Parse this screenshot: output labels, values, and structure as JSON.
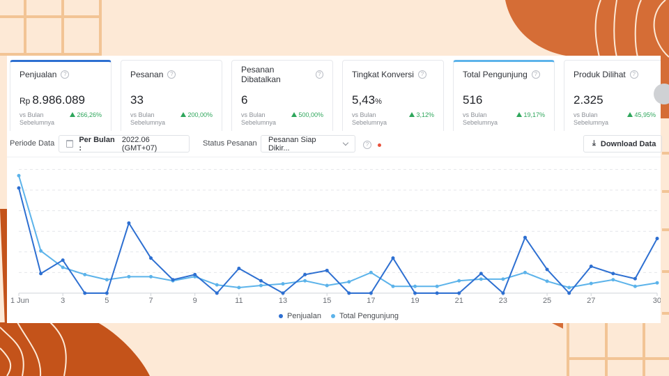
{
  "cards": [
    {
      "title": "Penjualan",
      "prefix": "Rp",
      "value": "8.986.089",
      "suffix": "",
      "vs_line1": "vs Bulan",
      "vs_line2": "Sebelumnya",
      "delta": "266,26%",
      "state": "active"
    },
    {
      "title": "Pesanan",
      "prefix": "",
      "value": "33",
      "suffix": "",
      "vs_line1": "vs Bulan",
      "vs_line2": "Sebelumnya",
      "delta": "200,00%",
      "state": ""
    },
    {
      "title": "Pesanan Dibatalkan",
      "prefix": "",
      "value": "6",
      "suffix": "",
      "vs_line1": "vs Bulan",
      "vs_line2": "Sebelumnya",
      "delta": "500,00%",
      "state": ""
    },
    {
      "title": "Tingkat Konversi",
      "prefix": "",
      "value": "5,43",
      "suffix": "%",
      "vs_line1": "vs Bulan",
      "vs_line2": "Sebelumnya",
      "delta": "3,12%",
      "state": ""
    },
    {
      "title": "Total Pengunjung",
      "prefix": "",
      "value": "516",
      "suffix": "",
      "vs_line1": "vs Bulan",
      "vs_line2": "Sebelumnya",
      "delta": "19,17%",
      "state": "active-light"
    },
    {
      "title": "Produk Dilihat",
      "prefix": "",
      "value": "2.325",
      "suffix": "",
      "vs_line1": "vs Bulan",
      "vs_line2": "Sebelumnya",
      "delta": "45,95%",
      "state": ""
    }
  ],
  "help_glyph": "?",
  "filters": {
    "period_label": "Periode Data",
    "period_bold": "Per Bulan :",
    "period_value": "2022.06 (GMT+07)",
    "status_label": "Status Pesanan",
    "status_value": "Pesanan Siap Dikir...",
    "download_label": "Download Data",
    "download_glyph": "⤓"
  },
  "colors": {
    "penjualan": "#2d6fd1",
    "pengunjung": "#5cb3ea",
    "positive": "#2ea65b",
    "accent_bg": "#d56d36",
    "page_bg": "#fde9d6"
  },
  "chart_data": {
    "type": "line",
    "title": "",
    "xlabel": "",
    "ylabel": "",
    "x": [
      1,
      2,
      3,
      4,
      5,
      6,
      7,
      8,
      9,
      10,
      11,
      12,
      13,
      14,
      15,
      16,
      17,
      18,
      19,
      20,
      21,
      22,
      23,
      24,
      25,
      26,
      27,
      28,
      29,
      30
    ],
    "x_tick_labels": [
      "1 Jun",
      "3",
      "5",
      "7",
      "9",
      "11",
      "13",
      "15",
      "17",
      "19",
      "21",
      "23",
      "25",
      "27",
      "30"
    ],
    "x_tick_positions": [
      1,
      3,
      5,
      7,
      9,
      11,
      13,
      15,
      17,
      19,
      21,
      23,
      25,
      27,
      30
    ],
    "y_unit_note": "relative grid units (no y-axis labels shown)",
    "ylim": [
      0,
      6
    ],
    "grid": true,
    "legend_position": "bottom-center",
    "series": [
      {
        "name": "Penjualan",
        "values": [
          5.1,
          0.95,
          1.6,
          0,
          0,
          3.4,
          1.7,
          0.65,
          0.9,
          0,
          1.2,
          0.6,
          0,
          0.9,
          1.1,
          0,
          0,
          1.7,
          0,
          0,
          0,
          0.95,
          0,
          2.7,
          1.15,
          0,
          1.3,
          0.95,
          0.7,
          2.65
        ]
      },
      {
        "name": "Total Pengunjung",
        "values": [
          5.7,
          2.05,
          1.25,
          0.9,
          0.65,
          0.8,
          0.8,
          0.6,
          0.8,
          0.4,
          0.27,
          0.37,
          0.45,
          0.6,
          0.37,
          0.55,
          1.0,
          0.33,
          0.33,
          0.33,
          0.6,
          0.68,
          0.68,
          1.0,
          0.58,
          0.27,
          0.47,
          0.65,
          0.33,
          0.5
        ]
      }
    ]
  }
}
